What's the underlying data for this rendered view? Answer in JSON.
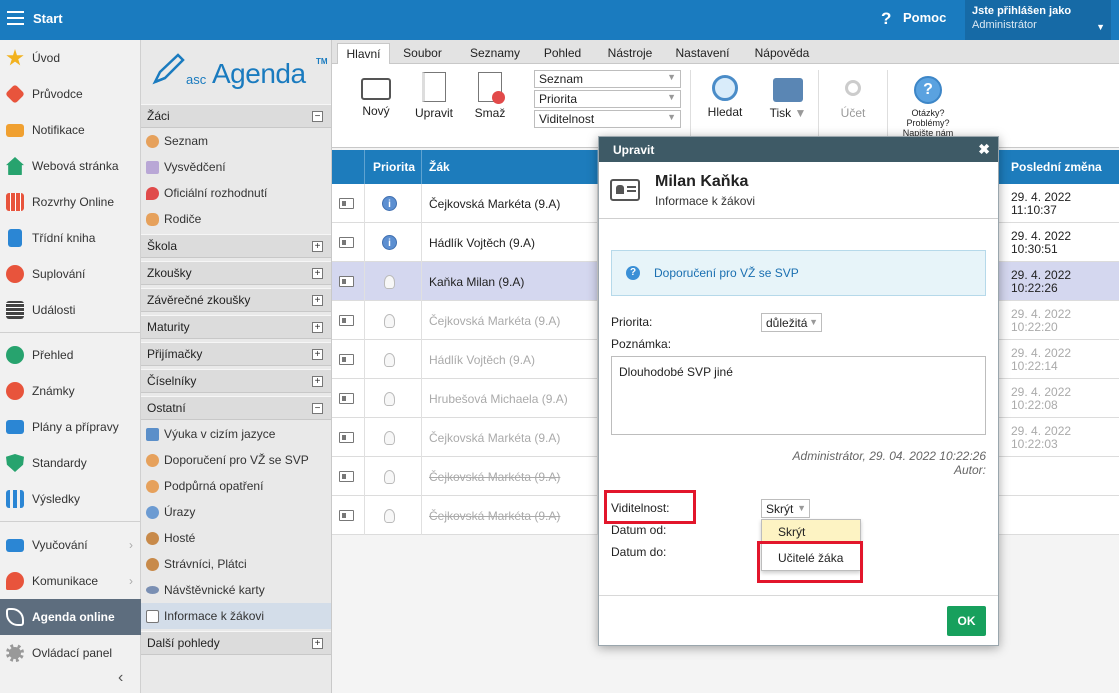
{
  "topbar": {
    "start_label": "Start",
    "help_label": "Pomoc",
    "user_line1": "Jste přihlášen jako",
    "user_line2": "Administrátor"
  },
  "leftnav": {
    "items": [
      {
        "label": "Úvod",
        "icon": "star-icon",
        "color": "#f2b21f"
      },
      {
        "label": "Průvodce",
        "icon": "magic-wand-icon",
        "color": "#e8543c"
      },
      {
        "label": "Notifikace",
        "icon": "envelope-icon",
        "color": "#f0a030"
      },
      {
        "label": "Webová stránka",
        "icon": "home-icon",
        "color": "#27a36e"
      },
      {
        "label": "Rozvrhy Online",
        "icon": "timetable-icon",
        "color": "#e8543c"
      },
      {
        "label": "Třídní kniha",
        "icon": "book-icon",
        "color": "#2b86d4"
      },
      {
        "label": "Suplování",
        "icon": "person-icon",
        "color": "#e8543c"
      },
      {
        "label": "Události",
        "icon": "calendar-icon",
        "color": "#444444"
      },
      {
        "label": "Přehled",
        "icon": "check-circle-icon",
        "color": "#27a36e"
      },
      {
        "label": "Známky",
        "icon": "grades-icon",
        "color": "#e8543c"
      },
      {
        "label": "Plány a přípravy",
        "icon": "briefcase-icon",
        "color": "#2b86d4"
      },
      {
        "label": "Standardy",
        "icon": "shield-icon",
        "color": "#27a36e"
      },
      {
        "label": "Výsledky",
        "icon": "bar-chart-icon",
        "color": "#2b86d4"
      },
      {
        "label": "Vyučování",
        "icon": "open-book-icon",
        "color": "#2b86d4"
      },
      {
        "label": "Komunikace",
        "icon": "chat-icon",
        "color": "#e8543c"
      },
      {
        "label": "Agenda online",
        "icon": "agenda-pen-icon",
        "color": "#ffffff"
      },
      {
        "label": "Ovládací panel",
        "icon": "gear-icon",
        "color": "#999999"
      }
    ]
  },
  "tree": {
    "logo_asc": "asc",
    "logo_agenda": "Agenda",
    "logo_tm": "TM",
    "sections": [
      {
        "label": "Žáci",
        "toggle": "−"
      },
      {
        "label": "Škola",
        "toggle": "+"
      },
      {
        "label": "Zkoušky",
        "toggle": "+"
      },
      {
        "label": "Závěrečné zkoušky",
        "toggle": "+"
      },
      {
        "label": "Maturity",
        "toggle": "+"
      },
      {
        "label": "Přijímačky",
        "toggle": "+"
      },
      {
        "label": "Číselníky",
        "toggle": "+"
      },
      {
        "label": "Ostatní",
        "toggle": "−"
      },
      {
        "label": "Další pohledy",
        "toggle": "+"
      }
    ],
    "zaci_items": [
      "Seznam",
      "Vysvědčení",
      "Oficiální rozhodnutí",
      "Rodiče"
    ],
    "ostatni_items": [
      "Výuka v cizím jazyce",
      "Doporučení pro VŽ se SVP",
      "Podpůrná opatření",
      "Úrazy",
      "Hosté",
      "Strávníci, Plátci",
      "Návštěvnické karty",
      "Informace k žákovi"
    ]
  },
  "tabs": [
    "Hlavní",
    "Soubor",
    "Seznamy",
    "Pohled",
    "Nástroje",
    "Nastavení",
    "Nápověda"
  ],
  "ribbon": {
    "new": "Nový",
    "edit": "Upravit",
    "delete": "Smaž",
    "dropdowns": [
      "Seznam",
      "Priorita",
      "Viditelnost"
    ],
    "search": "Hledat",
    "print": "Tisk",
    "account": "Účet",
    "questions": "Otázky? Problémy? Napište nám"
  },
  "grid": {
    "headers": {
      "priority": "Priorita",
      "student": "Žák",
      "last_change": "Poslední změna"
    },
    "rows": [
      {
        "student": "Čejkovská Markéta (9.A)",
        "date": "29. 4. 2022",
        "time": "11:10:37",
        "prio": "info",
        "state": "normal"
      },
      {
        "student": "Hádlík Vojtěch (9.A)",
        "date": "29. 4. 2022",
        "time": "10:30:51",
        "prio": "info",
        "state": "normal"
      },
      {
        "student": "Kaňka Milan (9.A)",
        "date": "29. 4. 2022",
        "time": "10:22:26",
        "prio": "bulb",
        "state": "selected"
      },
      {
        "student": "Čejkovská Markéta (9.A)",
        "date": "29. 4. 2022",
        "time": "10:22:20",
        "prio": "bulb",
        "state": "faded"
      },
      {
        "student": "Hádlík Vojtěch (9.A)",
        "date": "29. 4. 2022",
        "time": "10:22:14",
        "prio": "bulb",
        "state": "faded"
      },
      {
        "student": "Hrubešová Michaela (9.A)",
        "date": "29. 4. 2022",
        "time": "10:22:08",
        "prio": "bulb",
        "state": "faded"
      },
      {
        "student": "Čejkovská Markéta (9.A)",
        "date": "29. 4. 2022",
        "time": "10:22:03",
        "prio": "bulb",
        "state": "faded"
      },
      {
        "student": "Čejkovská Markéta (9.A)",
        "date": "",
        "time": "",
        "prio": "bulb",
        "state": "struck"
      },
      {
        "student": "Čejkovská Markéta (9.A)",
        "date": "",
        "time": "",
        "prio": "bulb",
        "state": "struck"
      }
    ]
  },
  "modal": {
    "title": "Upravit",
    "close": "✖",
    "name": "Milan Kaňka",
    "subtitle": "Informace k žákovi",
    "info_text": "Doporučení pro VŽ se SVP",
    "priority_label": "Priorita:",
    "priority_value": "důležitá",
    "note_label": "Poznámka:",
    "note_value": "Dlouhodobé SVP jiné",
    "meta_line1": "Administrátor, 29. 04. 2022 10:22:26",
    "meta_line2": "Autor:",
    "visibility_label": "Viditelnost:",
    "visibility_value": "Skrýt",
    "date_from_label": "Datum od:",
    "date_to_label": "Datum do:",
    "visibility_options": [
      "Skrýt",
      "Učitelé žáka"
    ],
    "ok": "OK"
  },
  "colors": {
    "topbar": "#1a7bbf",
    "grid_header": "#1d7cbc",
    "modal_title": "#3e5a66",
    "highlight": "#e2162b",
    "ok": "#17a05d"
  }
}
